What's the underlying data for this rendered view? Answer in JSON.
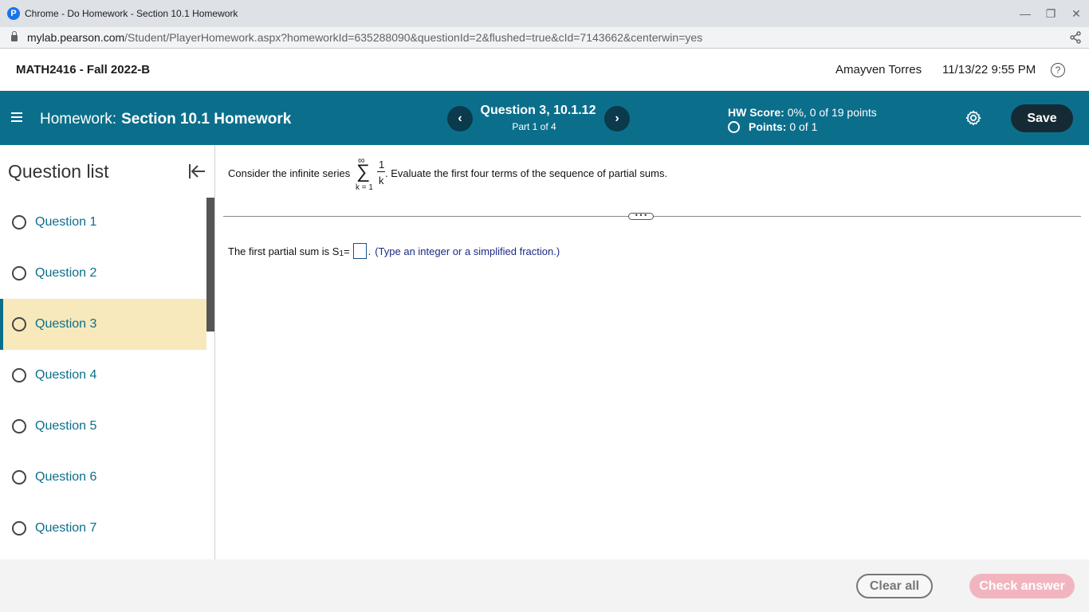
{
  "browser": {
    "window_title": "Chrome - Do Homework - Section 10.1 Homework",
    "app_icon_letter": "P",
    "url_host": "mylab.pearson.com",
    "url_path": "/Student/PlayerHomework.aspx?homeworkId=635288090&questionId=2&flushed=true&cId=7143662&centerwin=yes",
    "controls": {
      "minimize": "—",
      "restore": "❐",
      "close": "✕"
    }
  },
  "header": {
    "course": "MATH2416 - Fall 2022-B",
    "user": "Amayven Torres",
    "datetime": "11/13/22 9:55 PM",
    "help_symbol": "?"
  },
  "hw_bar": {
    "label": "Homework:",
    "name": "Section 10.1 Homework",
    "prev_symbol": "‹",
    "next_symbol": "›",
    "question_title": "Question 3, 10.1.12",
    "part": "Part 1 of 4",
    "score_label": "HW Score:",
    "score_value": "0%, 0 of 19 points",
    "points_label": "Points:",
    "points_value": "0 of 1",
    "save_label": "Save",
    "colors": {
      "bar": "#0b6f8c",
      "button": "#162a35"
    }
  },
  "sidebar": {
    "title": "Question list",
    "items": [
      {
        "label": "Question 1",
        "active": false
      },
      {
        "label": "Question 2",
        "active": false
      },
      {
        "label": "Question 3",
        "active": true
      },
      {
        "label": "Question 4",
        "active": false
      },
      {
        "label": "Question 5",
        "active": false
      },
      {
        "label": "Question 6",
        "active": false
      },
      {
        "label": "Question 7",
        "active": false
      }
    ]
  },
  "question": {
    "prompt_start": "Consider the infinite series",
    "sigma_upper": "∞",
    "sigma_symbol": "∑",
    "sigma_lower": "k = 1",
    "frac_num": "1",
    "frac_den": "k",
    "prompt_end": ". Evaluate the first four terms of the sequence of partial sums.",
    "divider_handle": "• • •",
    "answer_prefix": "The first partial sum is S",
    "answer_sub": "1",
    "answer_eq": " =",
    "answer_value": "",
    "answer_suffix": ".",
    "hint": "(Type an integer or a simplified fraction.)"
  },
  "footer": {
    "clear_label": "Clear all",
    "check_label": "Check answer"
  }
}
